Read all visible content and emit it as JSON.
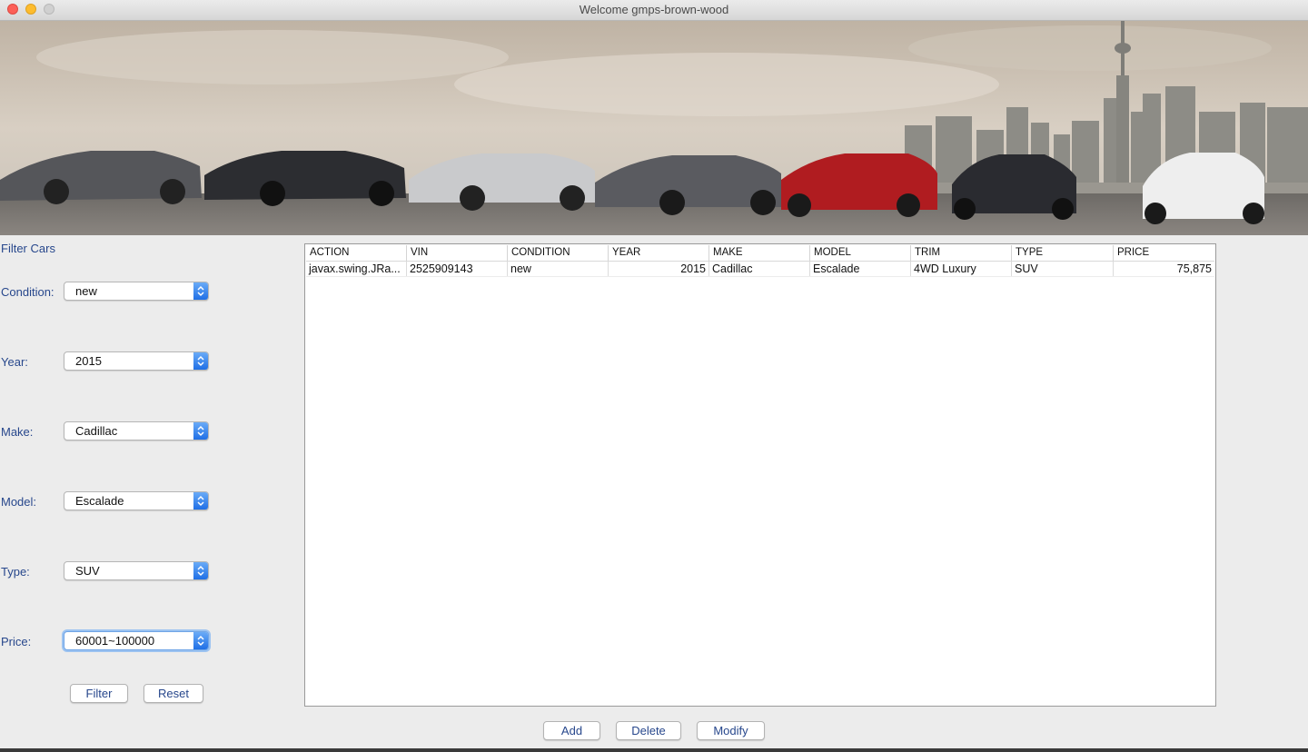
{
  "window": {
    "title": "Welcome gmps-brown-wood"
  },
  "banner": {
    "description_icon": "car-lineup-city-skyline-image"
  },
  "filter": {
    "title": "Filter Cars",
    "fields": [
      {
        "label": "Condition:",
        "value": "new"
      },
      {
        "label": "Year:",
        "value": "2015"
      },
      {
        "label": "Make:",
        "value": "Cadillac"
      },
      {
        "label": "Model:",
        "value": "Escalade"
      },
      {
        "label": "Type:",
        "value": "SUV"
      },
      {
        "label": "Price:",
        "value": "60001~100000"
      }
    ],
    "filter_label": "Filter",
    "reset_label": "Reset"
  },
  "table": {
    "columns": [
      "ACTION",
      "VIN",
      "CONDITION",
      "YEAR",
      "MAKE",
      "MODEL",
      "TRIM",
      "TYPE",
      "PRICE"
    ],
    "rows": [
      [
        "javax.swing.JRa...",
        "2525909143",
        "new",
        "2015",
        "Cadillac",
        "Escalade",
        "4WD Luxury",
        "SUV",
        "75,875"
      ]
    ]
  },
  "actions": {
    "add_label": "Add",
    "delete_label": "Delete",
    "modify_label": "Modify"
  },
  "colors": {
    "label_blue": "#27478c",
    "combo_arrow": "#2f7df0",
    "focus_ring": "#9cc3f1"
  }
}
